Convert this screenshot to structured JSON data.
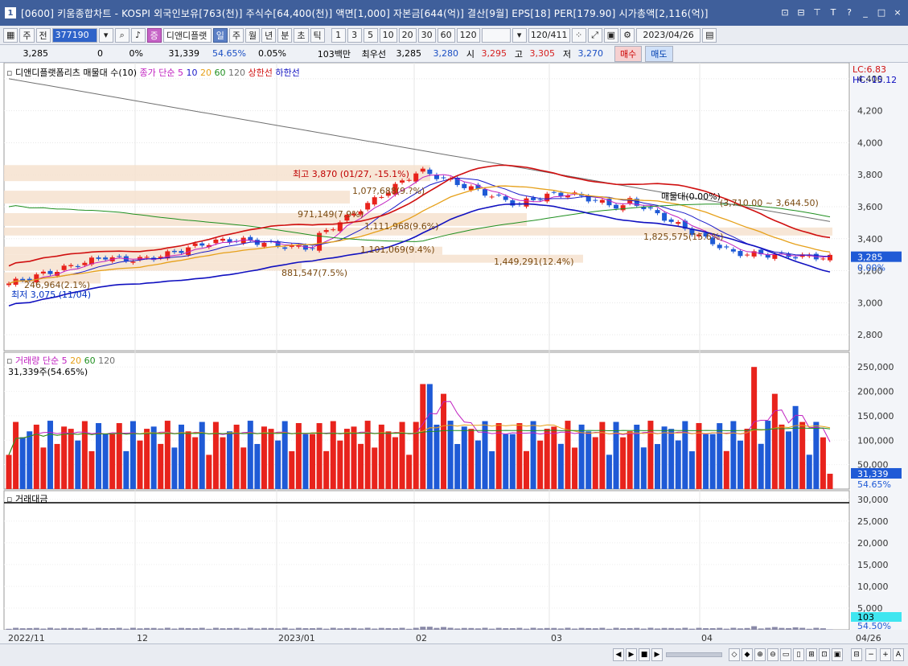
{
  "window": {
    "app_number": "1",
    "title": "[0600] 키움종합차트 - KOSPI 외국인보유[763(천)] 주식수[64,400(천)] 액면[1,000] 자본금[644(억)] 결산[9월] EPS[18] PER[179.90] 시가총액[2,116(억)]",
    "buttons": [
      "⊡",
      "⊟",
      "⊤",
      "T",
      "?",
      "_",
      "□",
      "×"
    ]
  },
  "toolbar": {
    "market": "주",
    "type": "전",
    "code": "377190",
    "stock_badge": "증",
    "stock_name": "디앤디플랫",
    "periods": [
      "일",
      "주",
      "월",
      "년",
      "분",
      "초",
      "틱"
    ],
    "selected_period": "일",
    "intervals": [
      "1",
      "3",
      "5",
      "10",
      "20",
      "30",
      "60",
      "120"
    ],
    "count": "120/411",
    "date": "2023/04/26"
  },
  "quote": {
    "price": "3,285",
    "change": "0",
    "change_pct": "0%",
    "volume": "31,339",
    "vol_ratio": "54.65%",
    "turnover": "0.05%",
    "amount": "103백만",
    "best_bid_label": "최우선",
    "best_bid": "3,285",
    "best_ask": "3,280",
    "open_label": "시",
    "open": "3,295",
    "high_label": "고",
    "high": "3,305",
    "low_label": "저",
    "low": "3,270",
    "buy_label": "매수",
    "sell_label": "매도"
  },
  "price_panel": {
    "legend_title": "디앤디플랫폼리츠 매물대 수(10)",
    "legend_ma_label": "종가 단순",
    "legend_ma_periods": [
      "5",
      "10",
      "20",
      "60",
      "120"
    ],
    "legend_upper": "상한선",
    "legend_lower": "하한선",
    "lc": "LC:6.83",
    "hc": "HC:-15.12",
    "current_price_tag": "3,285",
    "current_pct_tag": "0.00%",
    "y_ticks": [
      "4,400",
      "4,200",
      "4,000",
      "3,800",
      "3,600",
      "3,400",
      "3,200",
      "3,000",
      "2,800"
    ],
    "high_annotation": "최고 3,870 (01/27, -15.1%)",
    "low_annotation": "최저 3,075 (11/04)",
    "sell_off_label": "매물대(0.00%)",
    "volume_profile": [
      {
        "label": "1,07?,688(9.?%)",
        "row": 0
      },
      {
        "label": "971,149(7.9%)",
        "row": 1
      },
      {
        "label": "1,111,968(9.6%)",
        "row": 2
      },
      {
        "label": "1,825,575(15.6%)",
        "row": 3
      },
      {
        "label": "1,101,069(9.4%)",
        "row": 4
      },
      {
        "label": "1,449,291(12.4%)",
        "row": 5
      },
      {
        "label": "881,547(7.5%)",
        "row": 6
      },
      {
        "label": "246,964(2.1%)",
        "row": 7
      }
    ],
    "range_annotation": "(3,710.00 ~ 3,644.50)"
  },
  "volume_panel": {
    "legend_title": "거래량",
    "legend_ma_label": "단순",
    "legend_ma_periods": [
      "5",
      "20",
      "60",
      "120"
    ],
    "current_volume_text": "31,339주(54.65%)",
    "y_ticks": [
      "250,000",
      "200,000",
      "150,000",
      "100,000",
      "50,000"
    ],
    "current_tag": "31,339",
    "current_pct_tag": "54.65%"
  },
  "amount_panel": {
    "legend_title": "거래대금",
    "y_ticks": [
      "30,000",
      "25,000",
      "20,000",
      "15,000",
      "10,000",
      "5,000"
    ],
    "current_tag": "103",
    "current_pct_tag": "54.50%"
  },
  "x_axis": [
    "2022/11",
    "12",
    "2023/01",
    "02",
    "03",
    "04",
    "04/26"
  ],
  "colors": {
    "up": "#e8231c",
    "down": "#1f5ad6",
    "ma5": "#c020c0",
    "ma10": "#1a1ac8",
    "ma20": "#e6a019",
    "ma60": "#1f8f1f",
    "ma120": "#707070",
    "upper_band": "#d01010",
    "lower_band": "#1010c0",
    "profile": "#f6e2cf"
  }
}
